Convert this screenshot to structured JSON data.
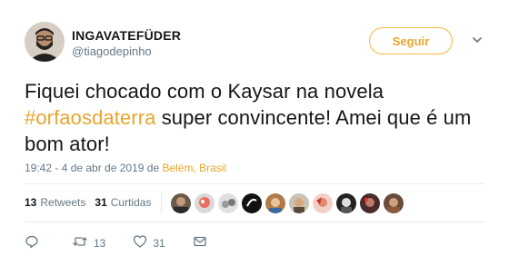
{
  "tweet": {
    "display_name": "INGAVATEFÜDER",
    "screen_name": "@tiagodepinho",
    "follow_label": "Seguir",
    "text_before": "Fiquei chocado com o Kaysar na novela ",
    "hashtag": "#orfaosdaterra",
    "text_after": " super convincente! Amei que é um bom ator!",
    "timestamp": "19:42 - 4 de abr de 2019",
    "location_prefix": " de ",
    "location": "Belém, Brasil"
  },
  "stats": {
    "retweets_count": "13",
    "retweets_label": "Retweets",
    "likes_count": "31",
    "likes_label": "Curtidas"
  },
  "actions": {
    "retweet_count": "13",
    "like_count": "31"
  },
  "colors": {
    "accent": "#e8a52f",
    "secondary_text": "#657786",
    "primary_text": "#14171a"
  }
}
